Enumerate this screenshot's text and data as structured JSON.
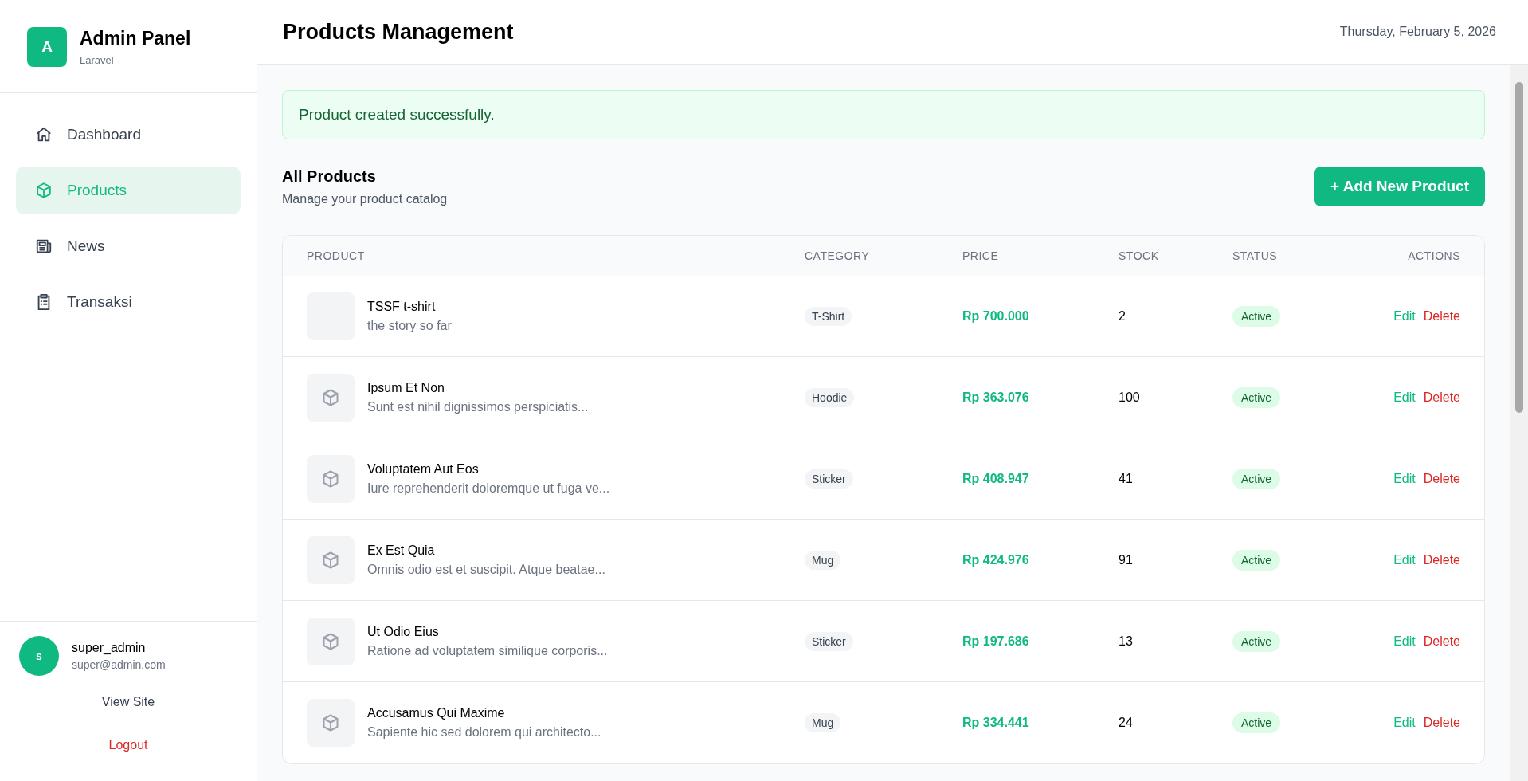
{
  "brand": {
    "logo_letter": "A",
    "title": "Admin Panel",
    "subtitle": "Laravel"
  },
  "sidebar": {
    "items": [
      {
        "label": "Dashboard",
        "selected": false
      },
      {
        "label": "Products",
        "selected": true
      },
      {
        "label": "News",
        "selected": false
      },
      {
        "label": "Transaksi",
        "selected": false
      }
    ]
  },
  "user": {
    "avatar_letter": "s",
    "name": "super_admin",
    "email": "super@admin.com",
    "view_site": "View Site",
    "logout": "Logout"
  },
  "header": {
    "title": "Products Management",
    "date": "Thursday, February 5, 2026"
  },
  "alert": "Product created successfully.",
  "section": {
    "title": "All Products",
    "subtitle": "Manage your product catalog",
    "add_button": "+ Add New Product"
  },
  "table": {
    "columns": [
      "PRODUCT",
      "CATEGORY",
      "PRICE",
      "STOCK",
      "STATUS",
      "ACTIONS"
    ],
    "rows": [
      {
        "kind": "photo",
        "name": "TSSF t-shirt",
        "description": "the story so far",
        "category": "T-Shirt",
        "price": "Rp 700.000",
        "stock": "2",
        "status": "Active",
        "edit": "Edit",
        "delete": "Delete"
      },
      {
        "kind": "placeholder",
        "name": "Ipsum Et Non",
        "description": "Sunt est nihil dignissimos perspiciatis...",
        "category": "Hoodie",
        "price": "Rp 363.076",
        "stock": "100",
        "status": "Active",
        "edit": "Edit",
        "delete": "Delete"
      },
      {
        "kind": "placeholder",
        "name": "Voluptatem Aut Eos",
        "description": "Iure reprehenderit doloremque ut fuga ve...",
        "category": "Sticker",
        "price": "Rp 408.947",
        "stock": "41",
        "status": "Active",
        "edit": "Edit",
        "delete": "Delete"
      },
      {
        "kind": "placeholder",
        "name": "Ex Est Quia",
        "description": "Omnis odio est et suscipit. Atque beatae...",
        "category": "Mug",
        "price": "Rp 424.976",
        "stock": "91",
        "status": "Active",
        "edit": "Edit",
        "delete": "Delete"
      },
      {
        "kind": "placeholder",
        "name": "Ut Odio Eius",
        "description": "Ratione ad voluptatem similique corporis...",
        "category": "Sticker",
        "price": "Rp 197.686",
        "stock": "13",
        "status": "Active",
        "edit": "Edit",
        "delete": "Delete"
      },
      {
        "kind": "placeholder",
        "name": "Accusamus Qui Maxime",
        "description": "Sapiente hic sed dolorem qui architecto...",
        "category": "Mug",
        "price": "Rp 334.441",
        "stock": "24",
        "status": "Active",
        "edit": "Edit",
        "delete": "Delete"
      }
    ]
  }
}
